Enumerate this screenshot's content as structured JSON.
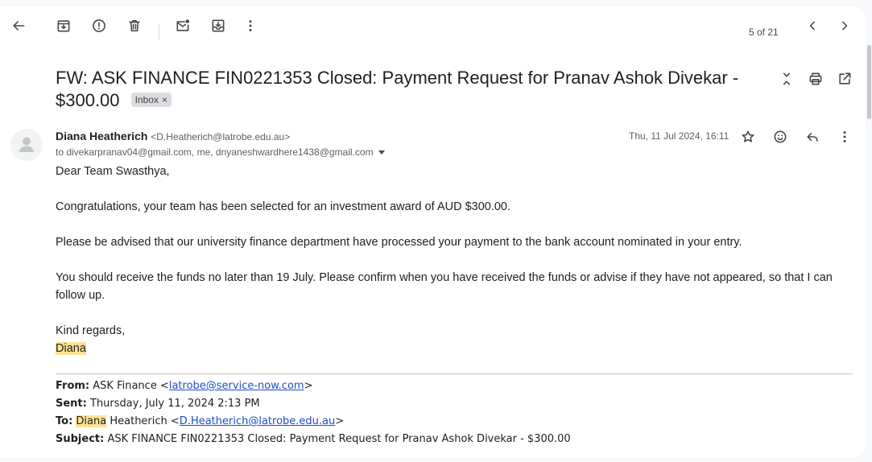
{
  "toolbar": {
    "back": "arrow-back-icon",
    "archive": "archive-icon",
    "spam": "report-spam-icon",
    "delete": "delete-icon",
    "mark_unread": "mark-unread-icon",
    "move_to": "move-to-icon",
    "more": "more-vert-icon",
    "counter": "5 of 21"
  },
  "subject": {
    "text": "FW: ASK FINANCE FIN0221353 Closed: Payment Request for Pranav Ashok Divekar - $300.00",
    "label": "Inbox",
    "label_remove": "×"
  },
  "message": {
    "sender_name": "Diana Heatherich",
    "sender_email": "<D.Heatherich@latrobe.edu.au>",
    "recipients": "to divekarpranav04@gmail.com, me, dnyaneshwardhere1438@gmail.com",
    "date": "Thu, 11 Jul 2024, 16:11"
  },
  "body": {
    "greeting": "Dear Team Swasthya,",
    "p1": "Congratulations, your team has been selected for an investment award of AUD $300.00.",
    "p2": "Please be advised that our university finance department have processed your payment to the bank account nominated in your entry.",
    "p3": "You should receive the funds no later than 19 July.  Please confirm when you have received the funds or advise if they have not appeared, so that I can follow up.",
    "closing": "Kind regards,",
    "signature": "Diana"
  },
  "forwarded": {
    "from_label": "From:",
    "from_name": "ASK Finance <",
    "from_email": "latrobe@service-now.com",
    "from_end": ">",
    "sent_label": "Sent:",
    "sent_value": "Thursday, July 11, 2024 2:13 PM",
    "to_label": "To:",
    "to_first": "Diana",
    "to_rest": " Heatherich <",
    "to_email": "D.Heatherich@latrobe.edu.au",
    "to_end": ">",
    "subject_label": "Subject:",
    "subject_value": "ASK FINANCE FIN0221353 Closed: Payment Request for Pranav Ashok Divekar - $300.00"
  },
  "colors": {
    "background": "#f6f8fc",
    "highlight": "#fde293",
    "link": "#1a4fc4"
  }
}
